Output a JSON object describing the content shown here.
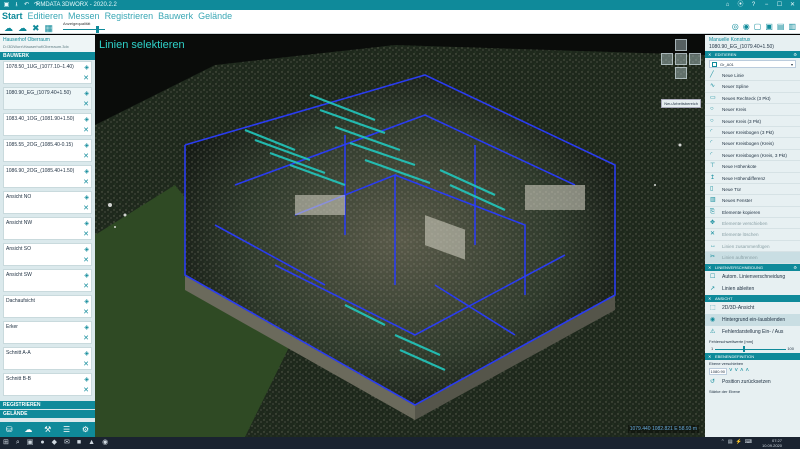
{
  "app": {
    "title": "RMDATA 3DWORX - 2020.2.2",
    "titlebar_left_icons": [
      "▣",
      "⭳",
      "↶",
      "↷"
    ],
    "titlebar_right_icons": [
      "⌂",
      "⦿",
      "?",
      "−",
      "☐",
      "✕"
    ]
  },
  "ribbon": {
    "menu": [
      {
        "label": "Start",
        "active": true
      },
      {
        "label": "Editieren",
        "active": false
      },
      {
        "label": "Messen",
        "active": false
      },
      {
        "label": "Registrieren",
        "active": false
      },
      {
        "label": "Bauwerk",
        "active": false
      },
      {
        "label": "Gelände",
        "active": false
      }
    ],
    "tool_icons": [
      "☁",
      "☁",
      "✖",
      "▦"
    ],
    "anzeigequalitaet_label": "Anzeigequalität",
    "anzeigequalitaet_level": 0.85,
    "right_icons": [
      "◎",
      "◉",
      "▢",
      "▣",
      "▤",
      "▥"
    ]
  },
  "left": {
    "project_title": "Hauserhof Oberraum",
    "project_subtitle": "D:\\3DWorx\\Hauserhof\\Oberraum.3dx",
    "section_title": "BAUWERK",
    "items": [
      {
        "label": "1078.50_1UG_(1077.10–1.40)"
      },
      {
        "label": "1080.90_EG_(1079.40+1.50)",
        "active": true
      },
      {
        "label": "1083.40_1OG_(1081.90+1.50)"
      },
      {
        "label": "1085.55_2OG_(1085.40-0.15)"
      },
      {
        "label": "1086.90_2OG_(1085.40+1.50)"
      },
      {
        "label": "Ansicht NO"
      },
      {
        "label": "Ansicht NW"
      },
      {
        "label": "Ansicht SO"
      },
      {
        "label": "Ansicht SW"
      },
      {
        "label": "Dachaufsicht"
      },
      {
        "label": "Erker"
      },
      {
        "label": "Schnitt A-A"
      },
      {
        "label": "Schnitt B-B"
      }
    ],
    "item_icons": {
      "eye": "◈",
      "close": "✕"
    },
    "bottom_sections": [
      "REGISTRIEREN",
      "GELÄNDE"
    ],
    "bottom_icons": [
      "⛁",
      "☁",
      "⚒",
      "☰",
      "⚙"
    ]
  },
  "viewport": {
    "mode_label": "Linien selektieren",
    "status": "1079.440 1082.821 E 58.93 m",
    "nav_tooltip": "Neu Arbeitsbereich"
  },
  "right": {
    "title": "Manuelle Konstrux",
    "subtitle": "1080.90_EG_(1079.40+1.50)",
    "editieren_header": "EDITIEREN",
    "layer_select": "Gr_A01",
    "tools": [
      {
        "label": "Neue Linie",
        "icon": "╱"
      },
      {
        "label": "Neuer Spline",
        "icon": "∿"
      },
      {
        "label": "Neues Rechteck (3 Pkt)",
        "icon": "▭"
      },
      {
        "label": "Neuer Kreis",
        "icon": "○"
      },
      {
        "label": "Neuer Kreis (3 Pkt)",
        "icon": "○"
      },
      {
        "label": "Neuer Kreisbogen (3 Pkt)",
        "icon": "◜"
      },
      {
        "label": "Neuer Kreisbogen (Kreis)",
        "icon": "◜"
      },
      {
        "label": "Neuer Kreisbogen (Kreis, 3 Pkt)",
        "icon": "◜"
      },
      {
        "label": "Neue Höhenkote",
        "icon": "⊤"
      },
      {
        "label": "Neue Höhendifferenz",
        "icon": "↥"
      },
      {
        "label": "Neue Tür",
        "icon": "▯"
      },
      {
        "label": "Neues Fenster",
        "icon": "▥"
      },
      {
        "label": "Elemente kopieren",
        "icon": "⎘"
      },
      {
        "label": "Elemente verschieben",
        "icon": "✥"
      },
      {
        "label": "Elemente löschen",
        "icon": "✕"
      },
      {
        "label": "Linien zusammenfügen",
        "icon": "↔"
      },
      {
        "label": "Linien auftrennen",
        "icon": "✂"
      }
    ],
    "linien_header": "LINIENVERSCHNEIDUNG",
    "linien_items": [
      {
        "label": "Autom. Linienverschneidung",
        "icon": "☐"
      },
      {
        "label": "Linien ableiten",
        "icon": "↗"
      }
    ],
    "ansicht_header": "ANSICHT",
    "ansicht_items": [
      {
        "label": "2D/3D-Ansicht",
        "icon": "⬚"
      },
      {
        "label": "Hintergrund ein-/ausblenden",
        "icon": "◉",
        "active": true
      },
      {
        "label": "Fehlerdarstellung Ein- / Aus",
        "icon": "⚠"
      }
    ],
    "fehler_label": "Fehlerschwellwerte [mm]",
    "fehler_min": "1",
    "fehler_max": "100",
    "fehler_level": 0.4,
    "ebene_header": "EBENENDEFINITION",
    "ebene_label": "Ebene verschieben",
    "ebene_value": "1080.90",
    "ebene_arrows": [
      "˅",
      "˅",
      "˄",
      "˄"
    ],
    "reset_label": "Position zurücksetzen",
    "staerke_label": "Stärke der Ebene",
    "section_close": "✕",
    "section_cog": "⚙",
    "select_arrow": "▾"
  },
  "taskbar": {
    "apps": [
      "⊞",
      "⌕",
      "▣",
      "●",
      "◆",
      "✉",
      "■",
      "▲",
      "◉"
    ],
    "tray": [
      "⌃",
      "▤",
      "⚡",
      "⌨"
    ],
    "time": "07:27",
    "date": "10.09.2020"
  }
}
